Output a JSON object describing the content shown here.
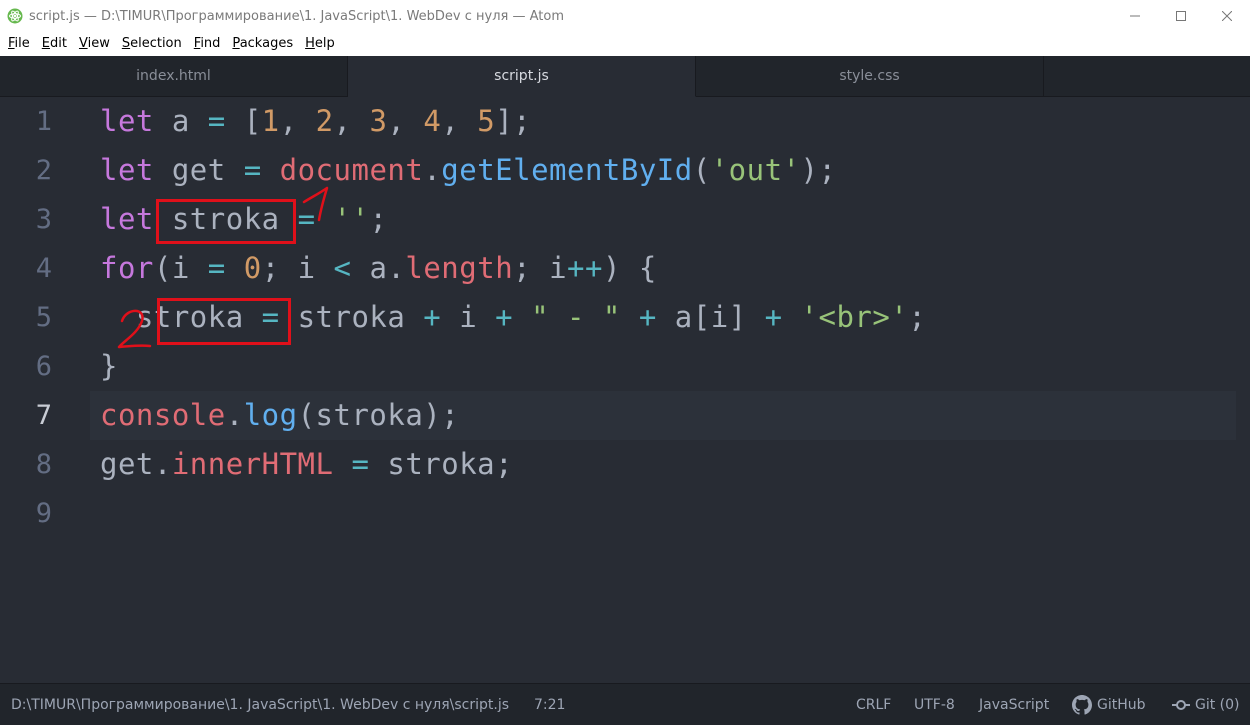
{
  "window": {
    "title": "script.js — D:\\TIMUR\\Программирование\\1. JavaScript\\1. WebDev с нуля — Atom",
    "controls": {
      "minimize": "—",
      "maximize": "☐",
      "close": "✕"
    }
  },
  "menu": {
    "items": [
      "File",
      "Edit",
      "View",
      "Selection",
      "Find",
      "Packages",
      "Help"
    ]
  },
  "tabs": [
    {
      "label": "index.html",
      "active": false
    },
    {
      "label": "script.js",
      "active": true
    },
    {
      "label": "style.css",
      "active": false
    }
  ],
  "editor": {
    "line_numbers": [
      "1",
      "2",
      "3",
      "4",
      "5",
      "6",
      "7",
      "8",
      "9"
    ],
    "current_line": "7",
    "lines": [
      [
        [
          "kw",
          "let"
        ],
        [
          "pl",
          " a "
        ],
        [
          "op",
          "="
        ],
        [
          "pl",
          " ["
        ],
        [
          "num",
          "1"
        ],
        [
          "pl",
          ", "
        ],
        [
          "num",
          "2"
        ],
        [
          "pl",
          ", "
        ],
        [
          "num",
          "3"
        ],
        [
          "pl",
          ", "
        ],
        [
          "num",
          "4"
        ],
        [
          "pl",
          ", "
        ],
        [
          "num",
          "5"
        ],
        [
          "pl",
          "];"
        ]
      ],
      [
        [
          "kw",
          "let"
        ],
        [
          "pl",
          " get "
        ],
        [
          "op",
          "="
        ],
        [
          "pl",
          " "
        ],
        [
          "obj",
          "document"
        ],
        [
          "pl",
          "."
        ],
        [
          "fn",
          "getElementById"
        ],
        [
          "pl",
          "("
        ],
        [
          "str",
          "'out'"
        ],
        [
          "pl",
          ");"
        ]
      ],
      [
        [
          "kw",
          "let"
        ],
        [
          "pl",
          " stroka "
        ],
        [
          "op",
          "="
        ],
        [
          "pl",
          " "
        ],
        [
          "str",
          "''"
        ],
        [
          "pl",
          ";"
        ]
      ],
      [
        [
          "kw",
          "for"
        ],
        [
          "pl",
          "(i "
        ],
        [
          "op",
          "="
        ],
        [
          "pl",
          " "
        ],
        [
          "num",
          "0"
        ],
        [
          "pl",
          "; i "
        ],
        [
          "op",
          "<"
        ],
        [
          "pl",
          " a."
        ],
        [
          "obj",
          "length"
        ],
        [
          "pl",
          "; i"
        ],
        [
          "op",
          "++"
        ],
        [
          "pl",
          ") {"
        ]
      ],
      [
        [
          "pl",
          "  stroka "
        ],
        [
          "op",
          "="
        ],
        [
          "pl",
          " stroka "
        ],
        [
          "op",
          "+"
        ],
        [
          "pl",
          " i "
        ],
        [
          "op",
          "+"
        ],
        [
          "pl",
          " "
        ],
        [
          "str",
          "\" - \""
        ],
        [
          "pl",
          " "
        ],
        [
          "op",
          "+"
        ],
        [
          "pl",
          " a[i] "
        ],
        [
          "op",
          "+"
        ],
        [
          "pl",
          " "
        ],
        [
          "str",
          "'<br>'"
        ],
        [
          "pl",
          ";"
        ]
      ],
      [
        [
          "pl",
          "}"
        ]
      ],
      [
        [
          "obj",
          "console"
        ],
        [
          "pl",
          "."
        ],
        [
          "fn",
          "log"
        ],
        [
          "pl",
          "(stroka);"
        ]
      ],
      [
        [
          "pl",
          "get."
        ],
        [
          "obj",
          "innerHTML"
        ],
        [
          "pl",
          " "
        ],
        [
          "op",
          "="
        ],
        [
          "pl",
          " stroka;"
        ]
      ],
      []
    ]
  },
  "annotations": {
    "mark_1": "1",
    "mark_2": "2",
    "color": "#e0101a"
  },
  "statusbar": {
    "file_path": "D:\\TIMUR\\Программирование\\1. JavaScript\\1. WebDev с нуля\\script.js",
    "cursor_position": "7:21",
    "line_ending": "CRLF",
    "encoding": "UTF-8",
    "grammar": "JavaScript",
    "github_label": "GitHub",
    "git_label": "Git (0)"
  }
}
